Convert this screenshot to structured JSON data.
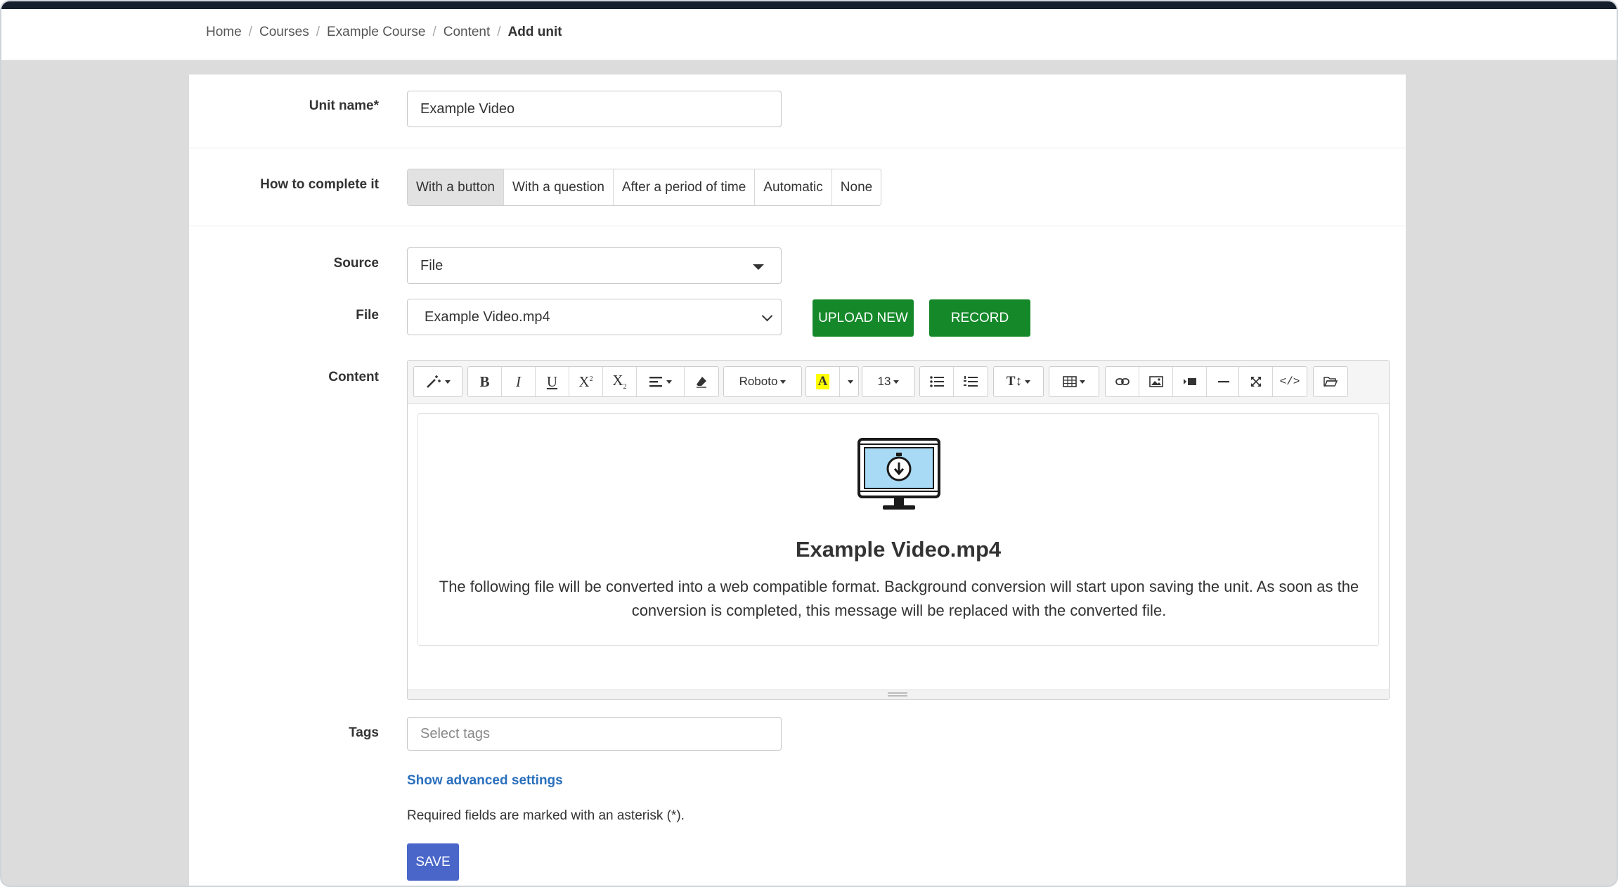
{
  "breadcrumb": {
    "items": [
      "Home",
      "Courses",
      "Example Course",
      "Content"
    ],
    "current": "Add unit"
  },
  "form": {
    "unit_name_label": "Unit name*",
    "unit_name_value": "Example Video",
    "complete_label": "How to complete it",
    "complete_options": [
      "With a button",
      "With a question",
      "After a period of time",
      "Automatic",
      "None"
    ],
    "complete_selected": "With a button",
    "source_label": "Source",
    "source_value": "File",
    "file_label": "File",
    "file_value": "Example Video.mp4",
    "upload_label": "UPLOAD NEW",
    "record_label": "RECORD",
    "content_label": "Content",
    "tags_label": "Tags",
    "tags_placeholder": "Select tags",
    "advanced_link": "Show advanced settings",
    "required_note": "Required fields are marked with an asterisk (*).",
    "save_label": "SAVE"
  },
  "toolbar": {
    "font_name": "Roboto",
    "font_size": "13",
    "bold": "B",
    "italic": "I",
    "underline": "U",
    "highlight_letter": "A",
    "highlight_color": "#ffff00",
    "text_height": "T↕",
    "code": "</>"
  },
  "editor": {
    "file_title": "Example Video.mp4",
    "file_message": "The following file will be converted into a web compatible format. Background conversion will start upon saving the unit. As soon as the conversion is completed, this message will be replaced with the converted file."
  },
  "colors": {
    "top_bar": "#16202c",
    "green": "#15892a",
    "save_blue": "#4a66c9",
    "link_blue": "#2a6fbd",
    "screen_blue": "#a8daf5"
  }
}
